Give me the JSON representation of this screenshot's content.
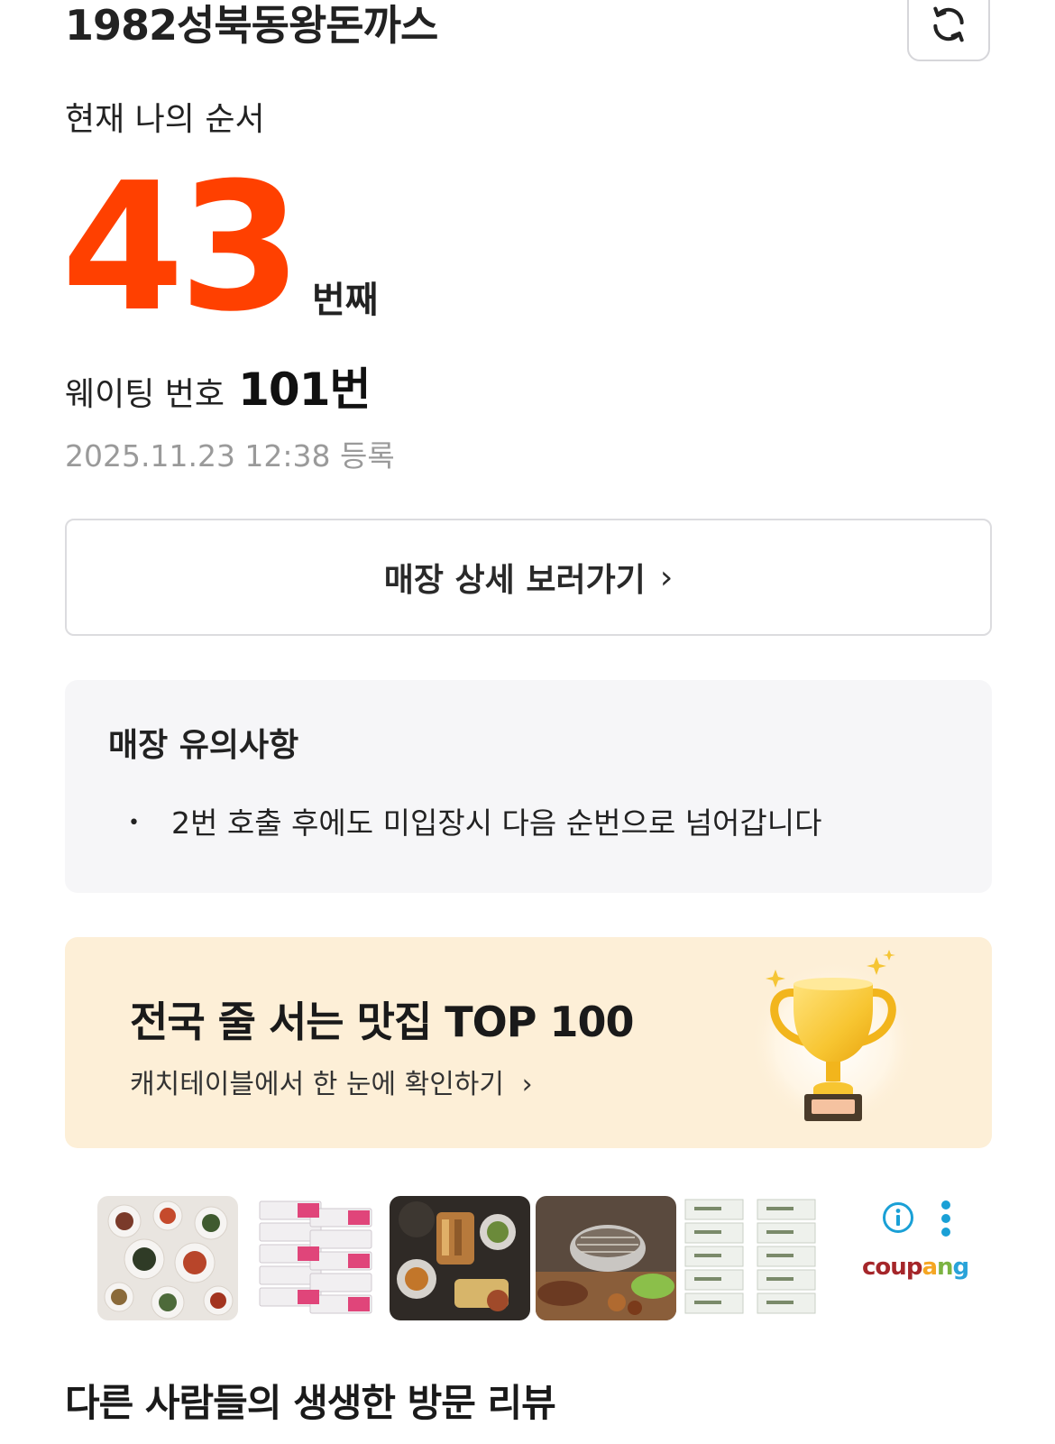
{
  "header": {
    "store_name": "1982성북동왕돈까스",
    "refresh_icon": "refresh-icon"
  },
  "queue": {
    "label": "현재 나의 순서",
    "position": "43",
    "position_suffix": "번째",
    "waiting_label": "웨이팅 번호",
    "waiting_number": "101번",
    "registered_at": "2025.11.23 12:38 등록",
    "accent_color": "#ff4000"
  },
  "detail_button": {
    "label": "매장 상세 보러가기",
    "chevron": "›"
  },
  "notice": {
    "title": "매장 유의사항",
    "items": [
      "2번 호출 후에도 미입장시 다음 순번으로 넘어갑니다"
    ],
    "bullet": "•"
  },
  "banner": {
    "title": "전국 줄 서는 맛집 TOP 100",
    "subtitle": "캐치테이블에서 한 눈에 확인하기",
    "chevron": "›",
    "icon": "trophy-icon",
    "background": "#fdefd7"
  },
  "ad": {
    "brand": "coupang",
    "icons": [
      "info-icon",
      "kebab-icon"
    ]
  },
  "reviews": {
    "title": "다른 사람들의 생생한 방문 리뷰"
  }
}
